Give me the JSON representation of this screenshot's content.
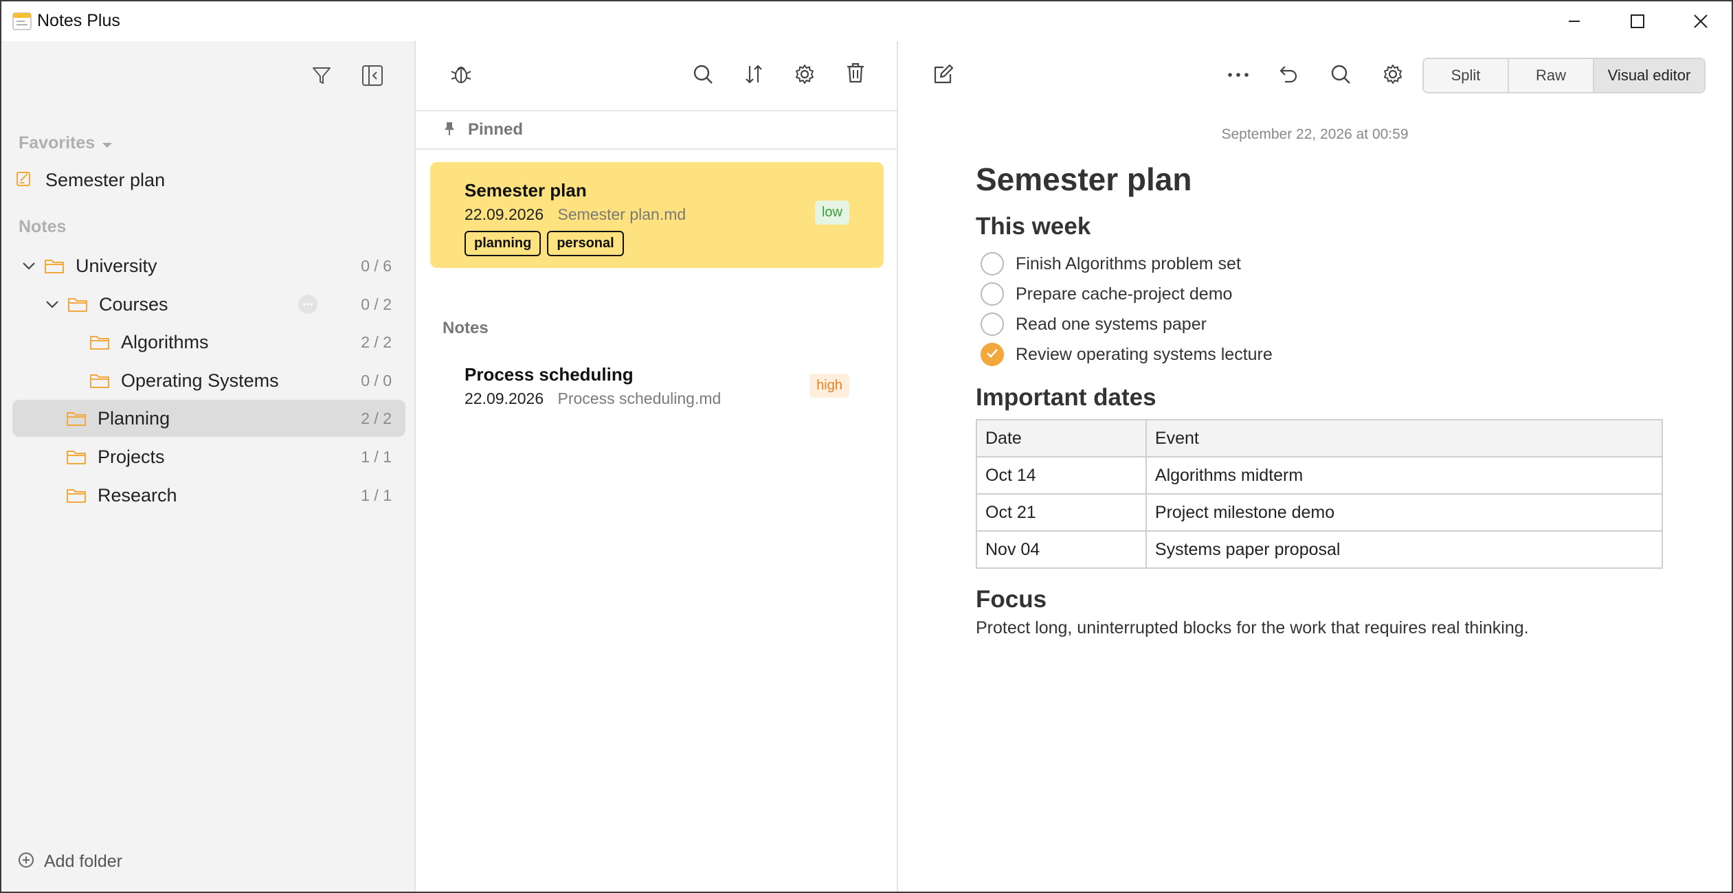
{
  "app": {
    "title": "Notes Plus"
  },
  "sidebar": {
    "favorites_label": "Favorites",
    "favorites": [
      {
        "label": "Semester plan",
        "icon": "edit-note-icon"
      }
    ],
    "notes_label": "Notes",
    "tree": [
      {
        "name": "University",
        "count": "0 / 6",
        "expanded": true
      },
      {
        "name": "Courses",
        "count": "0 / 2",
        "expanded": true
      },
      {
        "name": "Algorithms",
        "count": "2 / 2"
      },
      {
        "name": "Operating Systems",
        "count": "0 / 0"
      },
      {
        "name": "Planning",
        "count": "2 / 2",
        "selected": true
      },
      {
        "name": "Projects",
        "count": "1 / 1"
      },
      {
        "name": "Research",
        "count": "1 / 1"
      }
    ],
    "add_folder_label": "Add folder"
  },
  "notelist": {
    "pinned_label": "Pinned",
    "notes_label": "Notes",
    "pinned_note": {
      "title": "Semester plan",
      "date": "22.09.2026",
      "file": "Semester plan.md",
      "priority": "low",
      "tags": [
        "planning",
        "personal"
      ]
    },
    "notes": [
      {
        "title": "Process scheduling",
        "date": "22.09.2026",
        "file": "Process scheduling.md",
        "priority": "high"
      }
    ]
  },
  "editor": {
    "modes": [
      "Split",
      "Raw",
      "Visual editor"
    ],
    "active_mode": "Visual editor",
    "timestamp": "September 22, 2026 at 00:59",
    "title": "Semester plan",
    "this_week_heading": "This week",
    "tasks": [
      {
        "text": "Finish Algorithms problem set",
        "done": false
      },
      {
        "text": "Prepare cache-project demo",
        "done": false
      },
      {
        "text": "Read one systems paper",
        "done": false
      },
      {
        "text": "Review operating systems lecture",
        "done": true
      }
    ],
    "dates_heading": "Important dates",
    "dates_table": {
      "headers": [
        "Date",
        "Event"
      ],
      "rows": [
        [
          "Oct 14",
          "Algorithms midterm"
        ],
        [
          "Oct 21",
          "Project milestone demo"
        ],
        [
          "Nov 04",
          "Systems paper proposal"
        ]
      ]
    },
    "focus_heading": "Focus",
    "focus_text": "Protect long, uninterrupted blocks for the work that requires real thinking."
  },
  "colors": {
    "accent": "#f5b12f",
    "pinned_card": "#fde27f",
    "selected_row": "#dcdcdc",
    "priority_low": "#3d9a3f",
    "priority_high": "#e38323"
  }
}
